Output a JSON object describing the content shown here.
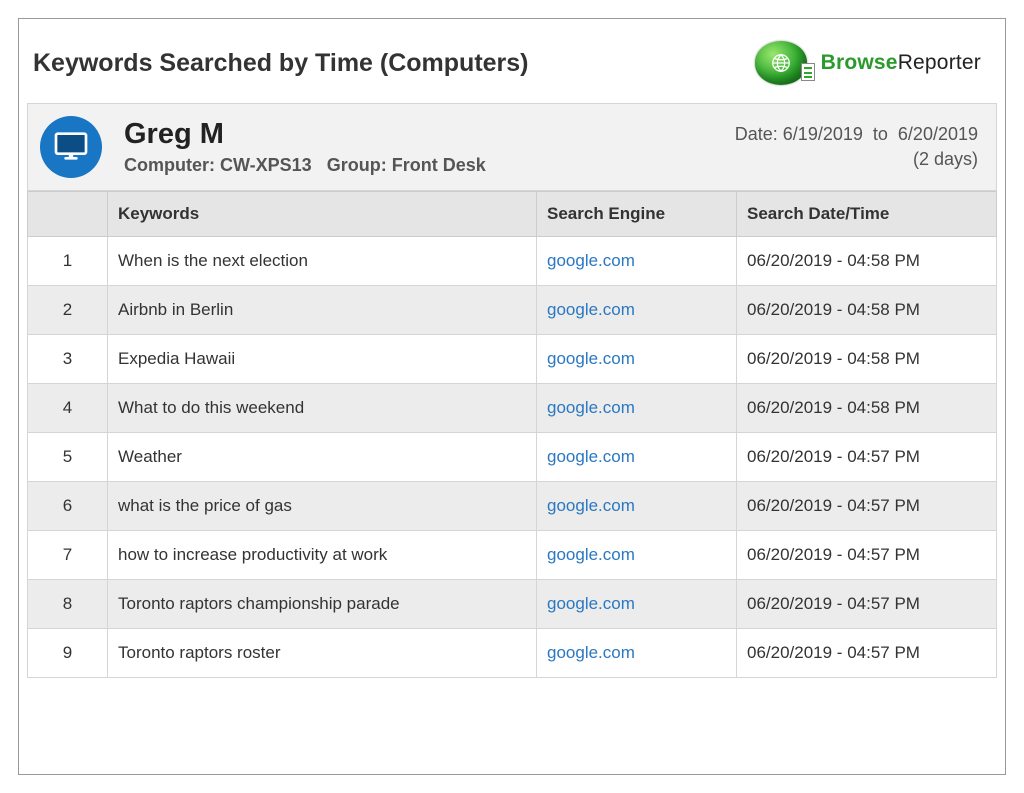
{
  "report": {
    "title": "Keywords Searched by Time (Computers)",
    "brand": {
      "part1": "Browse",
      "part2": "Reporter"
    }
  },
  "user": {
    "name": "Greg M",
    "computer_label": "Computer:",
    "computer": "CW-XPS13",
    "group_label": "Group:",
    "group": "Front Desk",
    "date_label": "Date:",
    "date_from": "6/19/2019",
    "date_to_word": "to",
    "date_to": "6/20/2019",
    "days": "(2 days)"
  },
  "columns": {
    "num": "",
    "keywords": "Keywords",
    "engine": "Search Engine",
    "datetime": "Search Date/Time"
  },
  "rows": [
    {
      "n": "1",
      "kw": "When is the next election",
      "eng": "google.com",
      "dt": "06/20/2019 - 04:58 PM"
    },
    {
      "n": "2",
      "kw": "Airbnb in Berlin",
      "eng": "google.com",
      "dt": "06/20/2019 - 04:58 PM"
    },
    {
      "n": "3",
      "kw": "Expedia Hawaii",
      "eng": "google.com",
      "dt": "06/20/2019 - 04:58 PM"
    },
    {
      "n": "4",
      "kw": "What to do this weekend",
      "eng": "google.com",
      "dt": "06/20/2019 - 04:58 PM"
    },
    {
      "n": "5",
      "kw": "Weather",
      "eng": "google.com",
      "dt": "06/20/2019 - 04:57 PM"
    },
    {
      "n": "6",
      "kw": "what is the price of gas",
      "eng": "google.com",
      "dt": "06/20/2019 - 04:57 PM"
    },
    {
      "n": "7",
      "kw": "how to increase productivity at work",
      "eng": "google.com",
      "dt": "06/20/2019 - 04:57 PM"
    },
    {
      "n": "8",
      "kw": "Toronto raptors championship parade",
      "eng": "google.com",
      "dt": "06/20/2019 - 04:57 PM"
    },
    {
      "n": "9",
      "kw": "Toronto raptors roster",
      "eng": "google.com",
      "dt": "06/20/2019 - 04:57 PM"
    }
  ]
}
